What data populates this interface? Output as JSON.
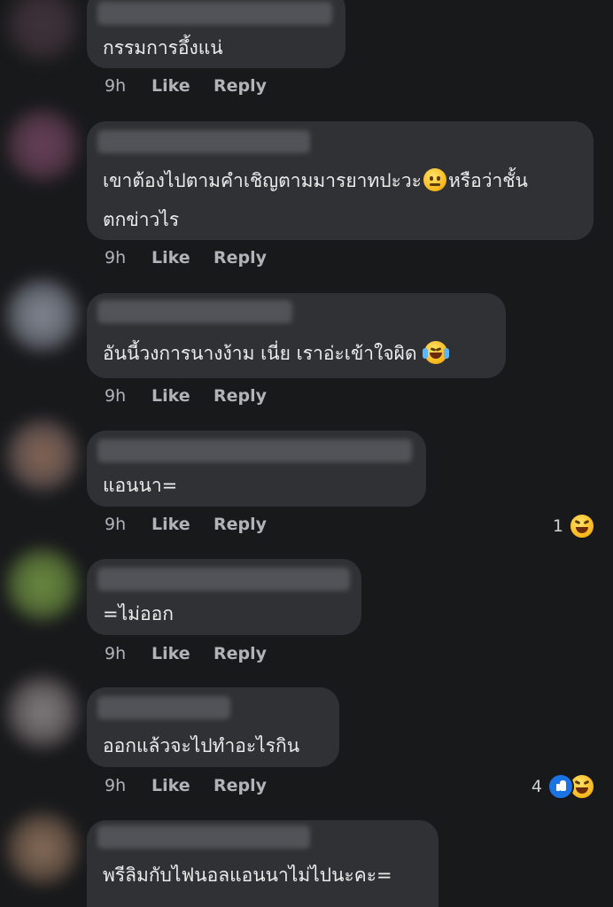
{
  "comments": [
    {
      "text": "กรรมการอึ้งแน่",
      "time": "9h",
      "like_label": "Like",
      "reply_label": "Reply",
      "reaction_count": ""
    },
    {
      "text_part1": "เขาต้องไปตามคำเชิญตามมารยาทปะวะ",
      "text_part2": "หรือว่าชั้น",
      "text_line2": "ตกข่าวไร",
      "emoji": "raised-eyebrow-emoji",
      "time": "9h",
      "like_label": "Like",
      "reply_label": "Reply",
      "reaction_count": ""
    },
    {
      "text": "อันนี้วงการนางง้าม เนี่ย เราอ่ะเข้าใจผิด",
      "emoji": "tears-of-joy-emoji",
      "time": "9h",
      "like_label": "Like",
      "reply_label": "Reply",
      "reaction_count": ""
    },
    {
      "text": "แอนนา=",
      "time": "9h",
      "like_label": "Like",
      "reply_label": "Reply",
      "reaction_count": "1",
      "reactions": [
        "haha-reaction-icon"
      ]
    },
    {
      "text": "=ไม่ออก",
      "time": "9h",
      "like_label": "Like",
      "reply_label": "Reply",
      "reaction_count": ""
    },
    {
      "text": "ออกแล้วจะไปทำอะไรกิน",
      "time": "9h",
      "like_label": "Like",
      "reply_label": "Reply",
      "reaction_count": "4",
      "reactions": [
        "like-reaction-icon",
        "haha-reaction-icon"
      ]
    },
    {
      "text": "พรีลิมกับไฟนอลแอนนาไม่ไปนะคะ=",
      "time": "",
      "like_label": "",
      "reply_label": "",
      "reaction_count": ""
    }
  ],
  "colors": {
    "background": "#18191b",
    "bubble": "#303134",
    "text": "#ececec",
    "meta": "#b0b3b8",
    "like_blue": "#1b74e4",
    "emoji_yellow": "#f7b519"
  }
}
